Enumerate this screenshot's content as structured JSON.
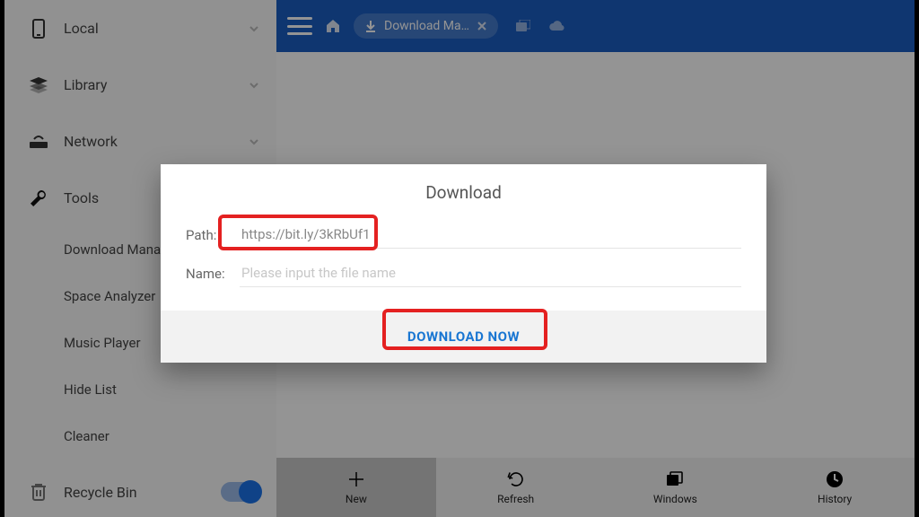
{
  "sidebar": {
    "local": "Local",
    "library": "Library",
    "network": "Network",
    "tools": "Tools",
    "tools_children": {
      "download_manager": "Download Mana",
      "space_analyzer": "Space Analyzer",
      "music_player": "Music Player",
      "hide_list": "Hide List",
      "cleaner": "Cleaner"
    },
    "recycle_bin": "Recycle Bin"
  },
  "topbar": {
    "tab_label": "Download Ma…"
  },
  "dialog": {
    "title": "Download",
    "path_label": "Path:",
    "path_value": "https://bit.ly/3kRbUf1",
    "name_label": "Name:",
    "name_placeholder": "Please input the file name",
    "button": "DOWNLOAD NOW"
  },
  "bottombar": {
    "new": "New",
    "refresh": "Refresh",
    "windows": "Windows",
    "history": "History"
  }
}
